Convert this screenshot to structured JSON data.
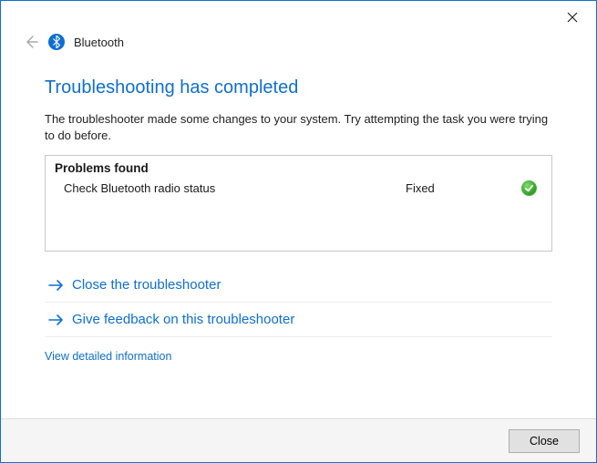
{
  "titlebar": {},
  "header": {
    "app_name": "Bluetooth"
  },
  "main": {
    "heading": "Troubleshooting has completed",
    "description": "The troubleshooter made some changes to your system. Try attempting the task you were trying to do before.",
    "problems_header": "Problems found",
    "problems": [
      {
        "label": "Check Bluetooth radio status",
        "status": "Fixed",
        "icon": "check"
      }
    ],
    "actions": {
      "close_troubleshooter": "Close the troubleshooter",
      "give_feedback": "Give feedback on this troubleshooter"
    },
    "detail_link": "View detailed information"
  },
  "footer": {
    "close_label": "Close"
  },
  "colors": {
    "accent": "#0f6fd1"
  }
}
